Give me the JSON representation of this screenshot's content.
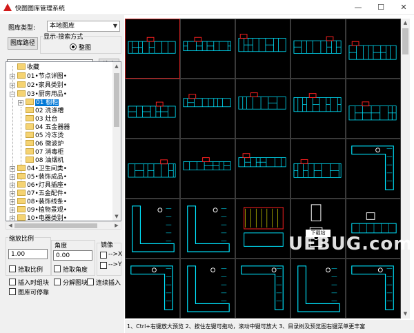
{
  "window": {
    "title": "快图图库管理系统",
    "minimize": "—",
    "maximize": "☐",
    "close": "✕"
  },
  "library": {
    "type_label": "图库类型:",
    "type_value": "本地图库",
    "path_button": "图库路径",
    "display_group_label": "显示-搜索方式",
    "display_option": "整图"
  },
  "search": {
    "input_value": "",
    "button_label": "搜索"
  },
  "tree": {
    "root": "收藏",
    "items": [
      {
        "label": "01•节点详图•",
        "expander": "+"
      },
      {
        "label": "02•家具类别•",
        "expander": "+"
      },
      {
        "label": "03•厨房用品•",
        "expander": "−"
      },
      {
        "label": "01 橱柜",
        "expander": "+",
        "selected": true
      },
      {
        "label": "02 洗涤槽"
      },
      {
        "label": "03 灶台"
      },
      {
        "label": "04 五金器器"
      },
      {
        "label": "05 冷冻烫"
      },
      {
        "label": "06 微波炉"
      },
      {
        "label": "07 消毒柜"
      },
      {
        "label": "08 油烟机"
      },
      {
        "label": "04•卫生间类•",
        "expander": "+"
      },
      {
        "label": "05•装饰成品•",
        "expander": "+"
      },
      {
        "label": "06•灯具插座•",
        "expander": "+"
      },
      {
        "label": "07•五金配件•",
        "expander": "+"
      },
      {
        "label": "08•装饰线条•",
        "expander": "+"
      },
      {
        "label": "09•植物景观•",
        "expander": "+"
      },
      {
        "label": "10•电器类别•",
        "expander": "+"
      }
    ]
  },
  "scale": {
    "label": "缩放比例",
    "value": "1.00",
    "pick_label": "拾取比例"
  },
  "angle": {
    "label": "角度",
    "value": "0.00",
    "pick_label": "拾取角度"
  },
  "mirror": {
    "label": "镜像",
    "x_label": "-->X",
    "y_label": "-->Y"
  },
  "options": {
    "insert_as_block": "插入时组块",
    "explode_block": "分解图块",
    "continuous_insert": "连续插入",
    "dockable": "图库可停靠"
  },
  "status_text": "1、Ctrl+右键放大预览   2、按住左键可拖动，滚动中键可放大   3、目录树及预览图右键菜单更丰富",
  "watermark": {
    "text": "UEBUG.com",
    "badge": "下载站"
  },
  "colors": {
    "cad_cyan": "#00e5ff",
    "cad_red": "#ff2020",
    "cad_yellow": "#ffff00",
    "cad_white": "#ffffff",
    "selection_blue": "#0078d7",
    "selected_cell_border": "#c81e1e"
  }
}
